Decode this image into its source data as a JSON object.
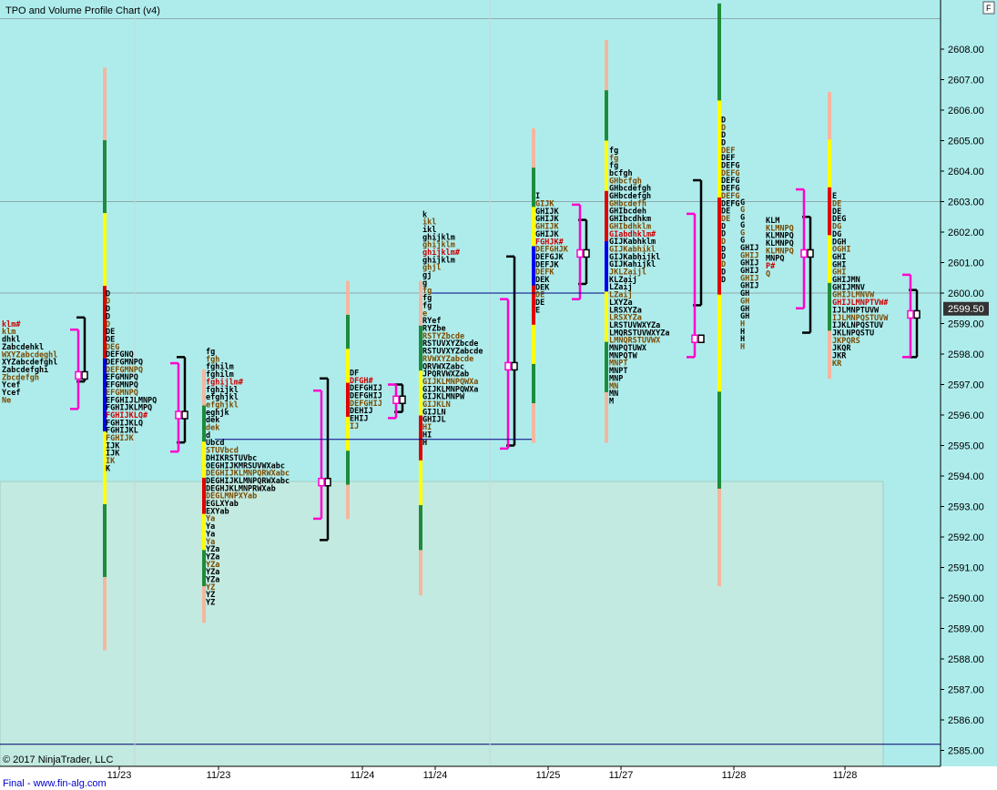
{
  "chart_data": {
    "type": "tpo_profile",
    "title": "TPO and Volume Profile Chart (v4)",
    "copyright": "© 2017 NinjaTrader, LLC",
    "footer": "Final - www.fin-alg.com",
    "corner_button": "F",
    "ylim": [
      2584.8,
      2610.4
    ],
    "y_ticks": [
      2585,
      2586,
      2587,
      2588,
      2589,
      2590,
      2591,
      2592,
      2593,
      2594,
      2595,
      2596,
      2597,
      2598,
      2599,
      2600,
      2601,
      2602,
      2603,
      2604,
      2605,
      2606,
      2607,
      2608
    ],
    "y_tick_format": "0.00",
    "current_price": 2599.5,
    "current_price_label": "2599.50",
    "horizontal_lines": [
      2609.0,
      2603.0,
      2600.0,
      2585.2
    ],
    "x_labels": [
      "11/23",
      "11/23",
      "11/24",
      "11/24",
      "11/25",
      "11/27",
      "11/28",
      "11/28"
    ],
    "colors": {
      "background": "#aeecec",
      "panel": "#c2eae0",
      "tpo_text": "#000000",
      "tpo_text_alt": "#7a4a00",
      "tpo_text_red": "#cc0000",
      "bar_salmon": "#f5b6a0",
      "bar_green": "#1e8c3a",
      "bar_yellow": "#ffff00",
      "bar_red": "#e00000",
      "bar_blue": "#0000ee",
      "bracket_black": "#000000",
      "bracket_magenta": "#ff00cc",
      "current_price_bg": "#333333"
    },
    "profiles": [
      {
        "label": "11/23",
        "top": 2598.9,
        "rows": [
          "klm#",
          "klm",
          "dhkl",
          "Zabcdehkl",
          "WXYZabcdeghl",
          "XYZabcdefghl",
          "Zabcdefghi",
          "Zbcdefgh",
          "Ycef",
          "Ycef",
          "Ne"
        ]
      },
      {
        "label": "11/23",
        "top": 2599.9,
        "rows": [
          "D",
          "D",
          "D",
          "D",
          "D",
          "DE",
          "OE",
          "DEG",
          "DEFGNQ",
          "DEFGMNPQ",
          "DEFGMNPQ",
          "EFGMNPQ",
          "EFGMNPQ",
          "EFGMNPQ",
          "EFGHIJLMNPQ",
          "FGHIJKLMPQ",
          "FGHIJKLQ#",
          "FGHIJKLQ",
          "FGHIJKL",
          "FGHIJK",
          "IJK",
          "IJK",
          "IK",
          "K"
        ]
      },
      {
        "label": "11/23",
        "top": 2598.0,
        "rows": [
          "fg",
          "fgh",
          "fghilm",
          "fghilm",
          "fghijlm#",
          "fghijkl",
          "efghjkl",
          "efghjkl",
          "eghjk",
          "dek",
          "dek",
          "d",
          "Ubcd",
          "STUVbcd",
          "DHIKRSTUVbc",
          "OEGHIJKMRSUVWXabc",
          "DEGHIJKLMNPQRWXabc",
          "DEGHIJKLMNPQRWXabc",
          "DEGHJKLMNPRWXab",
          "DEGLMNPXYab",
          "EGLXYab",
          "EXYab",
          "Ya",
          "Ya",
          "Ya",
          "Ya",
          "YZa",
          "YZa",
          "YZa",
          "YZa",
          "YZa",
          "YZ",
          "YZ",
          "YZ"
        ]
      },
      {
        "label": "11/24",
        "top": 2597.3,
        "rows": [
          "DF",
          "DFGH#",
          "DEFGHIJ",
          "DEFGHIJ",
          "DEFGHIJ",
          "DEHIJ",
          "EHIJ",
          "IJ"
        ]
      },
      {
        "label": "11/24",
        "top": 2602.5,
        "rows": [
          "k",
          "ikl",
          "ikl",
          "ghijklm",
          "ghijklm",
          "ghijklm#",
          "ghijklm",
          "ghjl",
          "gj",
          "g",
          "fg",
          "fg",
          "fg",
          "e",
          "RYef",
          "RYZbe",
          "RSTYZbcde",
          "RSTUVXYZbcde",
          "RSTUVXYZabcde",
          "RVWXYZabcde",
          "QRVWXZabc",
          "JPQRVWXZab",
          "GIJKLMNPQWXa",
          "GIJKLMNPQWXa",
          "GIJKLMNPW",
          "GIJKLN",
          "GIJLN",
          "GHIJL",
          "HI",
          "HI",
          "H"
        ]
      },
      {
        "label": "11/25",
        "top": 2603.1,
        "rows": [
          "I",
          "GIJK",
          "GHIJK",
          "GHIJK",
          "GHIJK",
          "GHIJK",
          "FGHJK#",
          "DEFGHJK",
          "DEFGJK",
          "DEFJK",
          "DEFK",
          "DEK",
          "DEK",
          "DE",
          "DE",
          "E"
        ]
      },
      {
        "label": "11/27",
        "top": 2604.6,
        "rows": [
          "fg",
          "fg",
          "fg",
          "bcfgh",
          "GHbcfgh",
          "GHbcdefgh",
          "GHbcdefgh",
          "GHbcdefh",
          "GHIbcdeh",
          "GHIbcdhkm",
          "GHIbdhklm",
          "GIabdhklm#",
          "GIJKabhklm",
          "GIJKabhikl",
          "GIJKabhijkl",
          "GIJKahijkl",
          "JKLZaijl",
          "KLZaij",
          "LZaij",
          "LZaij",
          "LXYZa",
          "LRSXYZa",
          "LRSXYZa",
          "LRSTUVWXYZa",
          "LMQRSTUVWXYZa",
          "LMNQRSTUVWX",
          "MNPQTUWX",
          "MNPQTW",
          "MNPT",
          "MNPT",
          "MNP",
          "MN",
          "MN",
          "M"
        ]
      },
      {
        "label": "11/28",
        "top": 2605.6,
        "rows": [
          "D",
          "D",
          "D",
          "D",
          "DEF",
          "DEF",
          "DEFG",
          "DEFG",
          "DEFG",
          "DEFG",
          "DEFG",
          "DEFG",
          "DE",
          "DE",
          "D",
          "D",
          "D",
          "D",
          "D",
          "D",
          "D",
          "D"
        ]
      },
      {
        "label": "11/28",
        "top": 2602.9,
        "rows": [
          "G",
          "G",
          "G",
          "G",
          "G",
          "G",
          "GHIJ",
          "GHIJ",
          "GHIJ",
          "GHIJ",
          "GHIJ",
          "GHIJ",
          "GH",
          "GH",
          "GH",
          "GH",
          "H",
          "H",
          "H",
          "H"
        ]
      },
      {
        "label": "11/28",
        "top": 2602.3,
        "rows": [
          "KLM",
          "KLMNPQ",
          "KLMNPQ",
          "KLMNPQ",
          "KLMNPQ",
          "MNPQ",
          "P#",
          "Q"
        ]
      },
      {
        "label": "11/28",
        "top": 2603.1,
        "rows": [
          "E",
          "DE",
          "DE",
          "DEG",
          "DG",
          "DG",
          "DGH",
          "OGHI",
          "GHI",
          "GHI",
          "GHI",
          "GHIJMN",
          "GHIJMNV",
          "GHIJLMNVW",
          "GHIJLMNPTVW#",
          "IJLMNPTUVW",
          "IJLMNPQSTUVW",
          "IJKLNPQSTUV",
          "JKLNPQSTU",
          "JKPQRS",
          "JKQR",
          "JKR",
          "KR"
        ]
      }
    ],
    "volume_bars": [
      {
        "label": "11/23",
        "low": 2588.3,
        "high": 2607.4,
        "segments": [
          "salmon",
          "green",
          "yellow",
          "red",
          "blue",
          "yellow",
          "green",
          "salmon"
        ]
      },
      {
        "label": "11/23",
        "low": 2589.2,
        "high": 2597.5,
        "segments": [
          "salmon",
          "green",
          "yellow",
          "red",
          "yellow",
          "green",
          "salmon"
        ]
      },
      {
        "label": "11/24",
        "low": 2592.6,
        "high": 2600.4,
        "segments": [
          "salmon",
          "green",
          "yellow",
          "red",
          "yellow",
          "green",
          "salmon"
        ]
      },
      {
        "label": "11/24",
        "low": 2590.1,
        "high": 2600.4,
        "segments": [
          "salmon",
          "green",
          "yellow",
          "red",
          "yellow",
          "green",
          "salmon"
        ]
      },
      {
        "label": "11/25",
        "low": 2595.1,
        "high": 2605.4,
        "segments": [
          "salmon",
          "green",
          "yellow",
          "blue",
          "red",
          "yellow",
          "green",
          "salmon"
        ]
      },
      {
        "label": "11/27",
        "low": 2595.1,
        "high": 2608.3,
        "segments": [
          "salmon",
          "green",
          "yellow",
          "red",
          "blue",
          "yellow",
          "green",
          "salmon"
        ]
      },
      {
        "label": "11/28",
        "low": 2590.4,
        "high": 2609.5,
        "segments": [
          "green",
          "yellow",
          "red",
          "yellow",
          "green",
          "salmon"
        ]
      },
      {
        "label": "11/28",
        "low": 2597.2,
        "high": 2606.6,
        "segments": [
          "salmon",
          "yellow",
          "red",
          "yellow",
          "green",
          "salmon"
        ]
      }
    ],
    "brackets": [
      {
        "color": "black",
        "low": 2597.1,
        "high": 2599.2,
        "marker": 2597.3
      },
      {
        "color": "magenta",
        "low": 2596.2,
        "high": 2598.8,
        "marker": 2597.3
      },
      {
        "color": "black",
        "low": 2595.1,
        "high": 2597.9,
        "marker": 2596.0
      },
      {
        "color": "magenta",
        "low": 2594.8,
        "high": 2597.7,
        "marker": 2596.0
      },
      {
        "color": "black",
        "low": 2591.9,
        "high": 2597.2,
        "marker": 2593.8
      },
      {
        "color": "magenta",
        "low": 2592.6,
        "high": 2596.8,
        "marker": 2593.8
      },
      {
        "color": "black",
        "low": 2596.1,
        "high": 2597.0,
        "marker": 2596.5
      },
      {
        "color": "magenta",
        "low": 2595.9,
        "high": 2597.0,
        "marker": 2596.5
      },
      {
        "color": "black",
        "low": 2595.0,
        "high": 2601.2,
        "marker": 2597.6
      },
      {
        "color": "magenta",
        "low": 2594.9,
        "high": 2599.8,
        "marker": 2597.6
      },
      {
        "color": "black",
        "low": 2600.3,
        "high": 2602.4,
        "marker": 2601.3
      },
      {
        "color": "magenta",
        "low": 2599.8,
        "high": 2602.9,
        "marker": 2601.3
      },
      {
        "color": "black",
        "low": 2599.6,
        "high": 2603.7,
        "marker": 2598.5
      },
      {
        "color": "magenta",
        "low": 2597.9,
        "high": 2602.6,
        "marker": 2598.5
      },
      {
        "color": "black",
        "low": 2598.7,
        "high": 2602.5,
        "marker": 2601.3
      },
      {
        "color": "magenta",
        "low": 2599.5,
        "high": 2603.4,
        "marker": 2601.3
      },
      {
        "color": "black",
        "low": 2597.9,
        "high": 2600.1,
        "marker": 2599.3
      },
      {
        "color": "magenta",
        "low": 2597.9,
        "high": 2600.6,
        "marker": 2599.3
      }
    ],
    "naked_poc_lines": [
      {
        "price": 2595.2,
        "from_profile": 2,
        "to_profile": 4
      },
      {
        "price": 2600.0,
        "from_profile": 4,
        "to_profile": 5
      }
    ]
  }
}
